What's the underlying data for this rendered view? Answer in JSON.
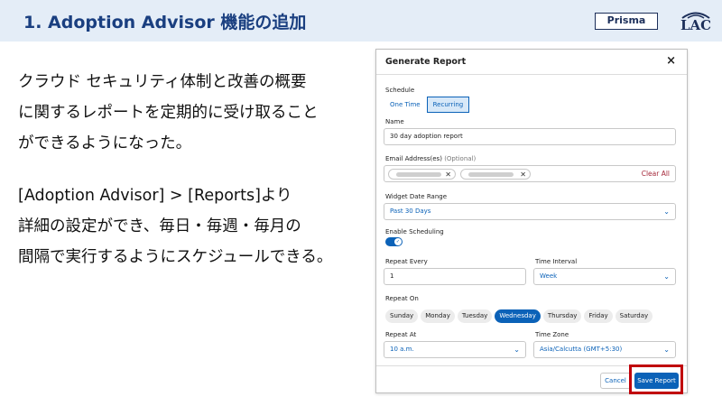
{
  "slide": {
    "title": "1. Adoption Advisor 機能の追加",
    "badge": "Prisma",
    "logo_text": "LAC",
    "paragraph1": [
      "クラウド セキュリティ体制と改善の概要",
      "に関するレポートを定期的に受け取ること",
      "ができるようになった。"
    ],
    "paragraph2": [
      "[Adoption Advisor] > [Reports]より",
      "詳細の設定ができ、毎日・毎週・毎月の",
      "間隔で実行するようにスケジュールできる。"
    ]
  },
  "modal": {
    "title": "Generate Report",
    "close_icon": "×",
    "schedule_label": "Schedule",
    "schedule_options": [
      "One Time",
      "Recurring"
    ],
    "schedule_selected": "Recurring",
    "name_label": "Name",
    "name_value": "30 day adoption report",
    "email_label": "Email Address(es)",
    "email_optional": "(Optional)",
    "clear_all": "Clear All",
    "chip_remove": "✕",
    "widget_range_label": "Widget Date Range",
    "widget_range_value": "Past 30 Days",
    "enable_scheduling_label": "Enable Scheduling",
    "enable_scheduling_on": true,
    "repeat_every_label": "Repeat Every",
    "repeat_every_value": "1",
    "time_interval_label": "Time Interval",
    "time_interval_value": "Week",
    "repeat_on_label": "Repeat On",
    "days": [
      "Sunday",
      "Monday",
      "Tuesday",
      "Wednesday",
      "Thursday",
      "Friday",
      "Saturday"
    ],
    "selected_day": "Wednesday",
    "repeat_at_label": "Repeat At",
    "repeat_at_value": "10 a.m.",
    "time_zone_label": "Time Zone",
    "time_zone_value": "Asia/Calcutta (GMT+5:30)",
    "cancel_label": "Cancel",
    "save_label": "Save Report"
  },
  "colors": {
    "accent": "#0b62b8",
    "title_blue": "#1a3f80",
    "header_bg": "#e4edf7",
    "highlight": "#c0000b",
    "clear_all": "#a5283a"
  }
}
